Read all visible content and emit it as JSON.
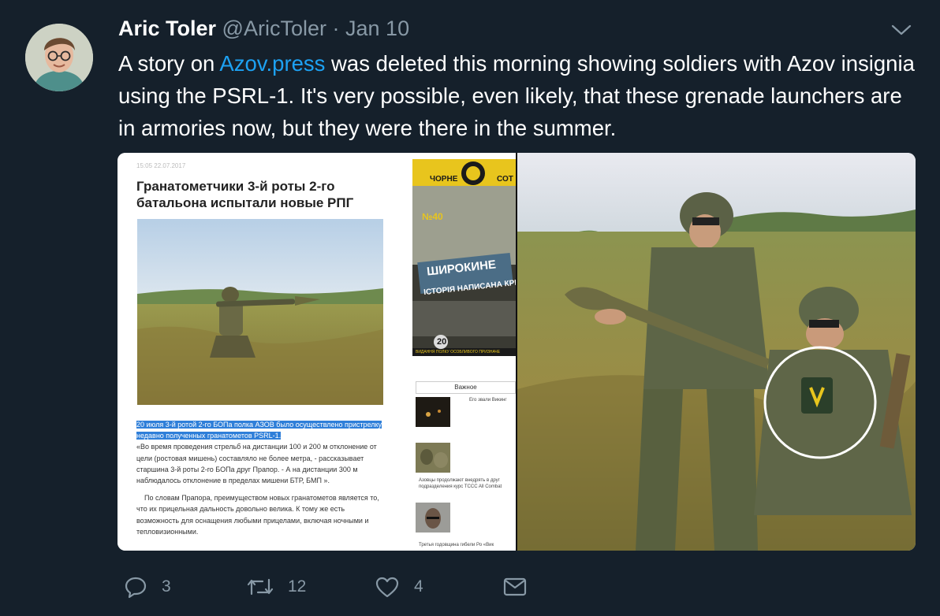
{
  "tweet": {
    "author_name": "Aric Toler",
    "author_handle": "@AricToler",
    "separator": "·",
    "date": "Jan 10",
    "text_before_link": "A story on ",
    "link_text": "Azov.press",
    "text_after_link": " was deleted this morning showing soldiers with Azov insignia using the PSRL-1.  It's very possible, even likely, that these grenade launchers are in armories now, but they were there in the summer."
  },
  "media": {
    "article": {
      "timestamp": "15:05 22.07.2017",
      "title": "Гранатометчики 3-й роты 2-го батальона испытали новые РПГ",
      "highlight": "20 июля 3-й ротой 2-го БОПа полка АЗОВ было осуществлено пристрелку недавно полученных гранатометов PSRL-1.",
      "paragraph1": "«Во время проведения стрельб на дистанции 100 и 200 м отклонение от цели (ростовая мишень) составляло не более метра, - рассказывает старшина 3-й роты 2-го БОПа друг Прапор. - А на дистанции 300 м наблюдалось отклонение в пределах мишени БТР, БМП ».",
      "paragraph2": "По словам Прапора, преимуществом новых гранатометов является то, что их прицельная дальность довольно велика. К тому же есть возможность для оснащения любыми прицелами, включая ночными и тепловизионными."
    },
    "magazine": {
      "banner_left": "ЧОРНЕ",
      "banner_right": "СОТ",
      "issue": "№40",
      "sign_line1": "ШИРОКИНЕ",
      "sign_line2": "ІСТОРІЯ НАПИСАНА КРІ",
      "badge": "20",
      "footer": "ВИДАННЯ ПОЛКУ ОСОБЛИВОГО ПРИЗНАЧЕ"
    },
    "sidebar": {
      "heading": "Важное",
      "item1_caption": "Его звали Викинг",
      "item2_caption": "Азовцы продолжают внедрять в друг подразделения курс TCCC All Combat",
      "item3_caption": "Третья годовщина гибели Ро «Вик"
    }
  },
  "actions": {
    "replies": "3",
    "retweets": "12",
    "likes": "4"
  },
  "colors": {
    "background": "#15202b",
    "link": "#1da1f2",
    "muted": "#8899a6",
    "highlight": "#2f7fd9"
  },
  "icons": [
    "reply-icon",
    "retweet-icon",
    "like-icon",
    "direct-message-icon",
    "chevron-down-icon"
  ]
}
